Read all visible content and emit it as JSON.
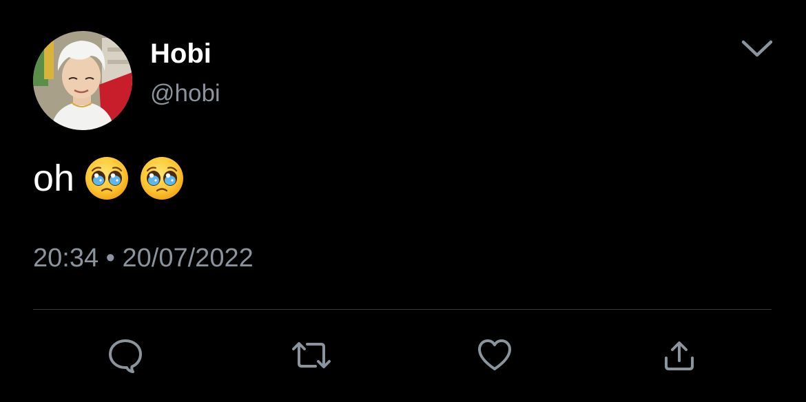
{
  "tweet": {
    "display_name": "Hobi",
    "handle": "@hobi",
    "text": "oh",
    "emojis": [
      "pleading-face",
      "pleading-face"
    ],
    "time": "20:34",
    "separator": "•",
    "date": "20/07/2022"
  },
  "actions": [
    "reply-icon",
    "retweet-icon",
    "like-icon",
    "share-icon"
  ],
  "colors": {
    "background": "#000000",
    "primary_text": "#ffffff",
    "secondary_text": "#8b949c",
    "icon": "#8b949c",
    "divider": "#3a3d41"
  }
}
